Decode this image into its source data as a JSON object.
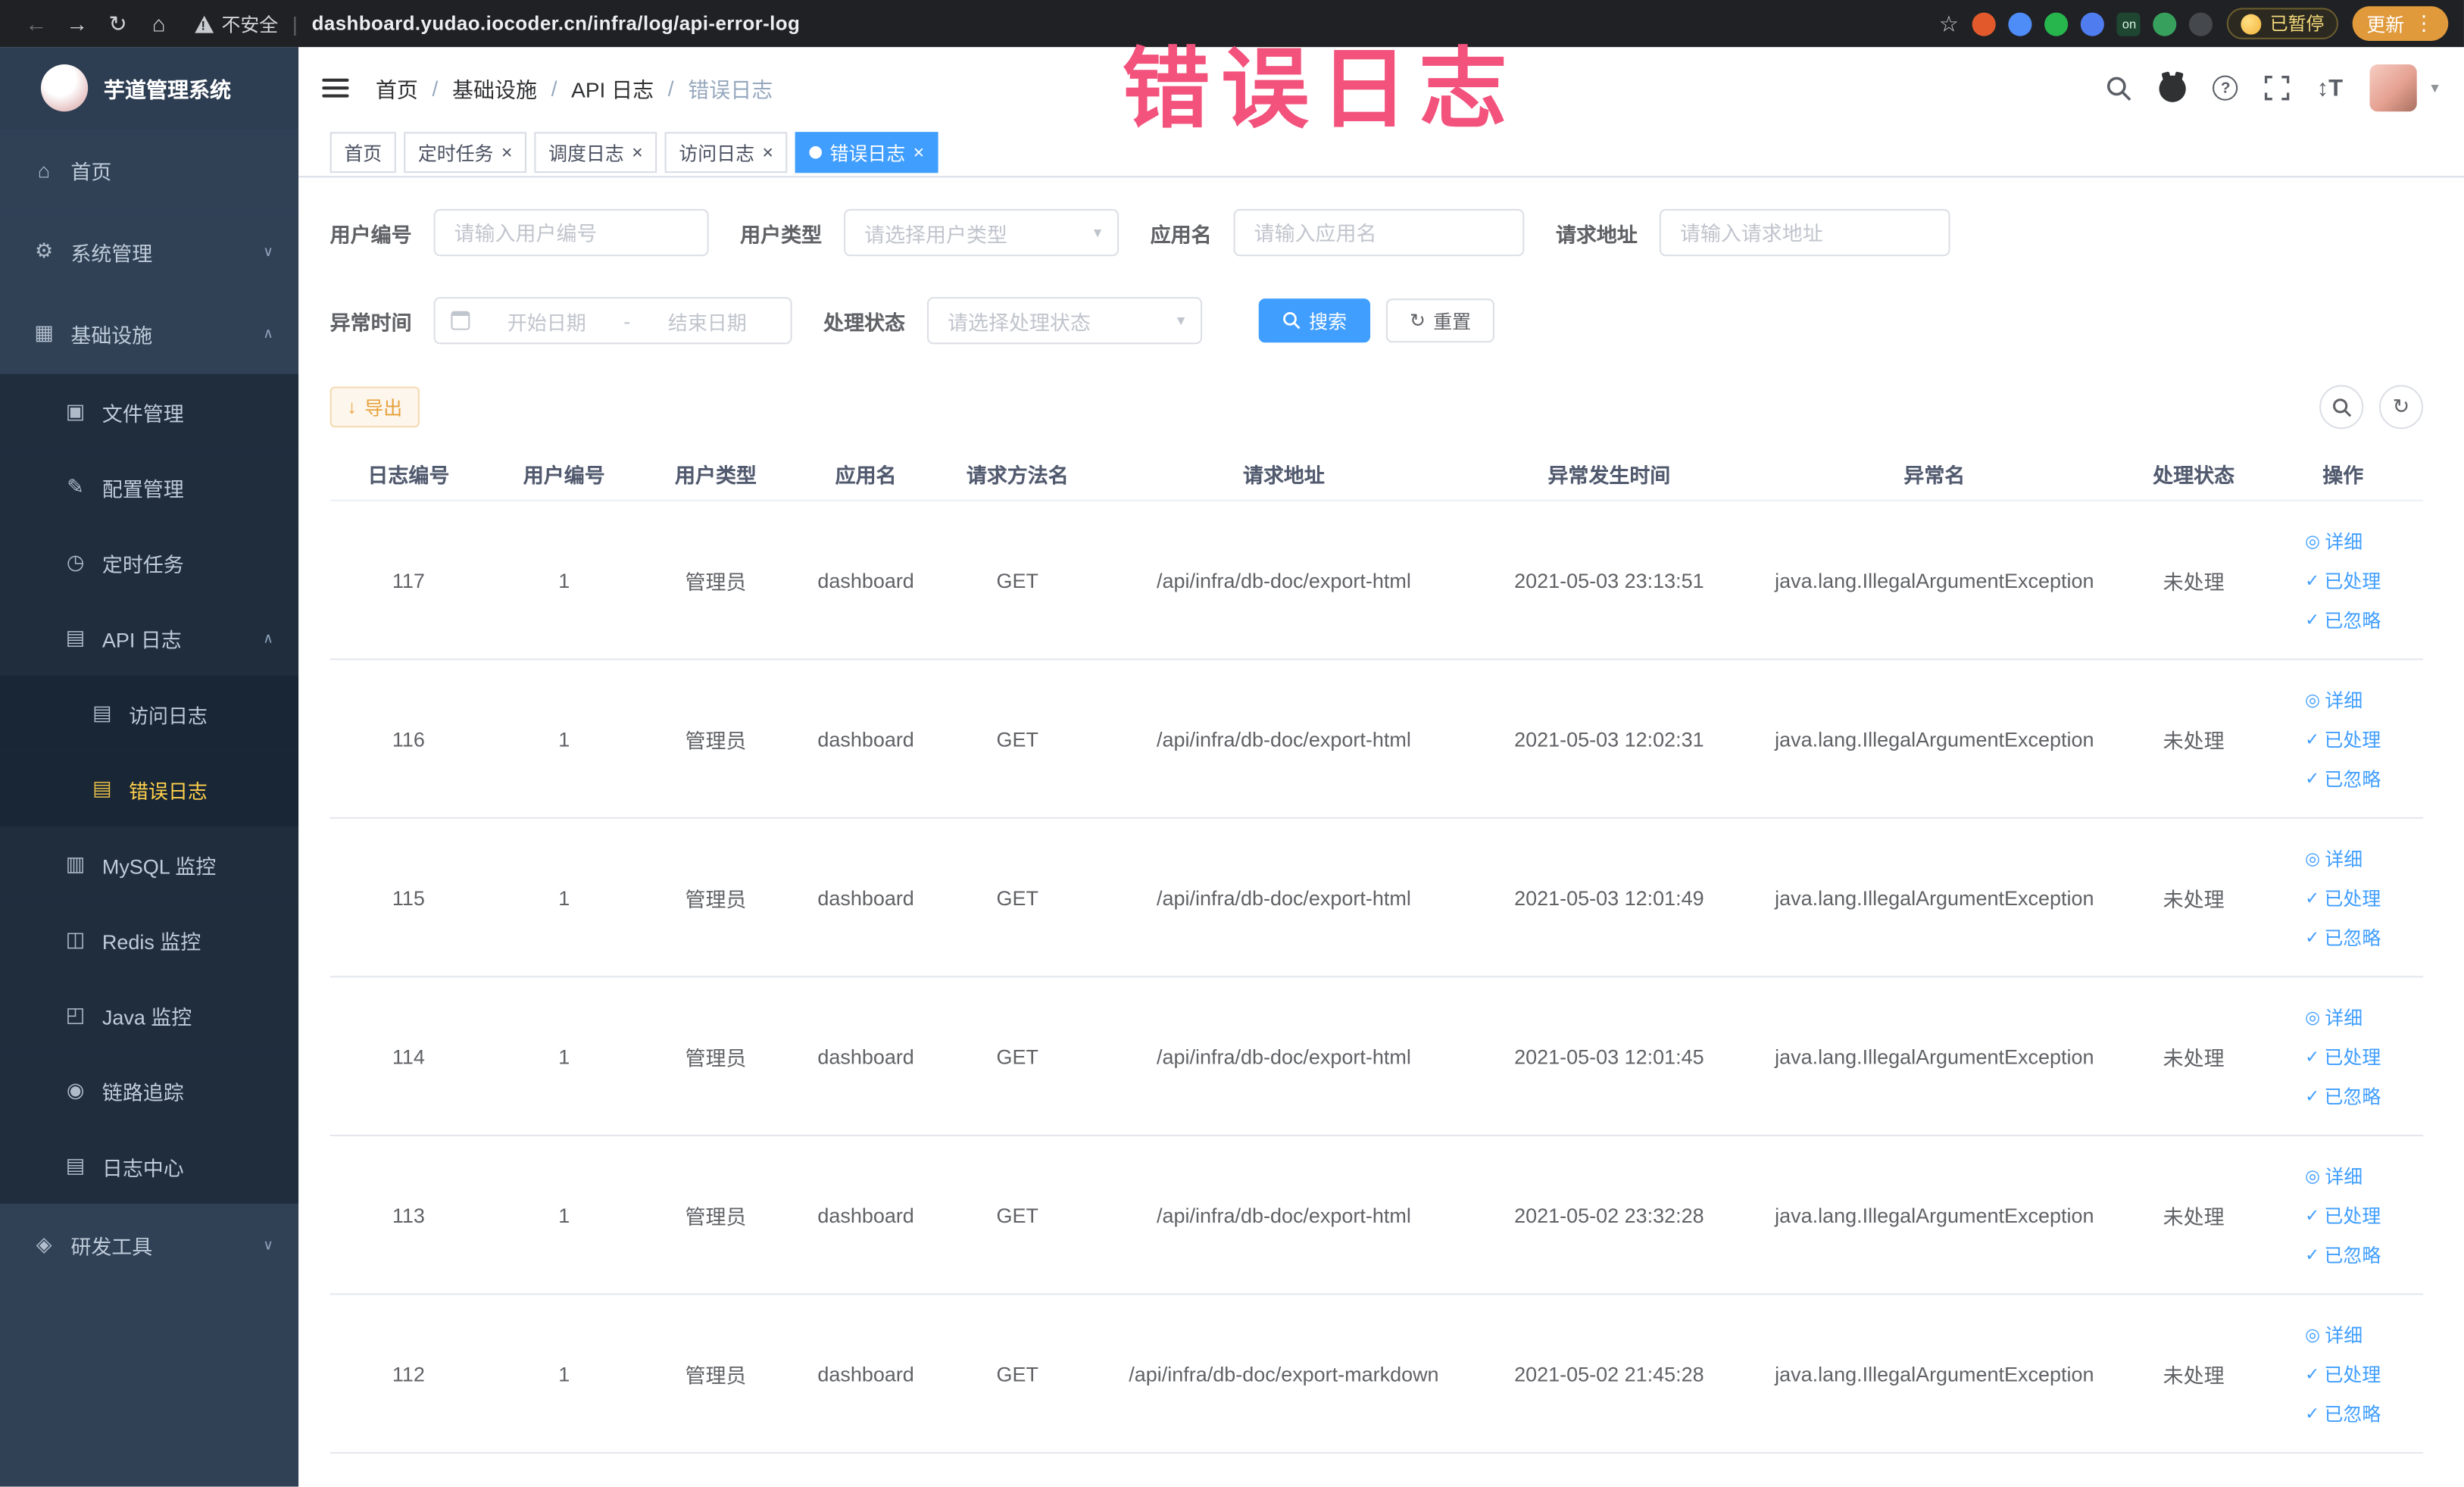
{
  "annotation": {
    "text": "错误日志"
  },
  "browser": {
    "security_label": "不安全",
    "url": "dashboard.yudao.iocoder.cn/infra/log/api-error-log",
    "paused_badge": "已暂停",
    "update_button": "更新",
    "extensions": [
      {
        "icon": "extension-dot-icon",
        "color": "#e25a2b"
      },
      {
        "icon": "extension-drop-icon",
        "color": "#4e8cf7"
      },
      {
        "icon": "extension-circle-icon",
        "color": "#27b64e"
      },
      {
        "icon": "extension-grid-icon",
        "color": "#4f7df0"
      },
      {
        "icon": "extension-on-badge-icon",
        "color": "#1e4631",
        "label": "on"
      },
      {
        "icon": "extension-leaf-icon",
        "color": "#37a05c"
      },
      {
        "icon": "extension-pin-icon",
        "color": "#45484c"
      }
    ]
  },
  "sidebar": {
    "logo_title": "芋道管理系统",
    "items": [
      {
        "label": "首页",
        "icon": "home-icon",
        "level": 0
      },
      {
        "label": "系统管理",
        "icon": "gear-icon",
        "level": 0,
        "chevron": "down"
      },
      {
        "label": "基础设施",
        "icon": "infra-icon",
        "level": 0,
        "chevron": "up"
      },
      {
        "label": "文件管理",
        "icon": "file-icon",
        "level": 1
      },
      {
        "label": "配置管理",
        "icon": "config-icon",
        "level": 1
      },
      {
        "label": "定时任务",
        "icon": "job-icon",
        "level": 1
      },
      {
        "label": "API 日志",
        "icon": "api-log-icon",
        "level": 1,
        "chevron": "up"
      },
      {
        "label": "访问日志",
        "icon": "doc-icon",
        "level": 2
      },
      {
        "label": "错误日志",
        "icon": "doc-icon",
        "level": 2,
        "active": true
      },
      {
        "label": "MySQL 监控",
        "icon": "mysql-icon",
        "level": 1
      },
      {
        "label": "Redis 监控",
        "icon": "redis-icon",
        "level": 1
      },
      {
        "label": "Java 监控",
        "icon": "java-icon",
        "level": 1
      },
      {
        "label": "链路追踪",
        "icon": "trace-icon",
        "level": 1
      },
      {
        "label": "日志中心",
        "icon": "log-center-icon",
        "level": 1
      },
      {
        "label": "研发工具",
        "icon": "tool-icon",
        "level": 0,
        "chevron": "down"
      }
    ]
  },
  "header": {
    "breadcrumb": [
      "首页",
      "基础设施",
      "API 日志",
      "错误日志"
    ]
  },
  "tabs": [
    {
      "label": "首页",
      "closable": false,
      "active": false
    },
    {
      "label": "定时任务",
      "closable": true,
      "active": false
    },
    {
      "label": "调度日志",
      "closable": true,
      "active": false
    },
    {
      "label": "访问日志",
      "closable": true,
      "active": false
    },
    {
      "label": "错误日志",
      "closable": true,
      "active": true
    }
  ],
  "filters": {
    "user_id_label": "用户编号",
    "user_id_placeholder": "请输入用户编号",
    "user_type_label": "用户类型",
    "user_type_placeholder": "请选择用户类型",
    "app_name_label": "应用名",
    "app_name_placeholder": "请输入应用名",
    "request_url_label": "请求地址",
    "request_url_placeholder": "请输入请求地址",
    "exception_time_label": "异常时间",
    "date_start_placeholder": "开始日期",
    "date_separator": "-",
    "date_end_placeholder": "结束日期",
    "status_label": "处理状态",
    "status_placeholder": "请选择处理状态",
    "search_button": "搜索",
    "reset_button": "重置"
  },
  "toolbar": {
    "export_button": "导出"
  },
  "table": {
    "columns": [
      "日志编号",
      "用户编号",
      "用户类型",
      "应用名",
      "请求方法名",
      "请求地址",
      "异常发生时间",
      "异常名",
      "处理状态",
      "操作"
    ],
    "actions": {
      "detail": "详细",
      "processed": "已处理",
      "ignored": "已忽略"
    },
    "rows": [
      {
        "log_id": "117",
        "user_id": "1",
        "user_type": "管理员",
        "app": "dashboard",
        "method": "GET",
        "url": "/api/infra/db-doc/export-html",
        "time": "2021-05-03 23:13:51",
        "exception": "java.lang.IllegalArgumentException",
        "status": "未处理"
      },
      {
        "log_id": "116",
        "user_id": "1",
        "user_type": "管理员",
        "app": "dashboard",
        "method": "GET",
        "url": "/api/infra/db-doc/export-html",
        "time": "2021-05-03 12:02:31",
        "exception": "java.lang.IllegalArgumentException",
        "status": "未处理"
      },
      {
        "log_id": "115",
        "user_id": "1",
        "user_type": "管理员",
        "app": "dashboard",
        "method": "GET",
        "url": "/api/infra/db-doc/export-html",
        "time": "2021-05-03 12:01:49",
        "exception": "java.lang.IllegalArgumentException",
        "status": "未处理"
      },
      {
        "log_id": "114",
        "user_id": "1",
        "user_type": "管理员",
        "app": "dashboard",
        "method": "GET",
        "url": "/api/infra/db-doc/export-html",
        "time": "2021-05-03 12:01:45",
        "exception": "java.lang.IllegalArgumentException",
        "status": "未处理"
      },
      {
        "log_id": "113",
        "user_id": "1",
        "user_type": "管理员",
        "app": "dashboard",
        "method": "GET",
        "url": "/api/infra/db-doc/export-html",
        "time": "2021-05-02 23:32:28",
        "exception": "java.lang.IllegalArgumentException",
        "status": "未处理"
      },
      {
        "log_id": "112",
        "user_id": "1",
        "user_type": "管理员",
        "app": "dashboard",
        "method": "GET",
        "url": "/api/infra/db-doc/export-markdown",
        "time": "2021-05-02 21:45:28",
        "exception": "java.lang.IllegalArgumentException",
        "status": "未处理"
      }
    ]
  },
  "colors": {
    "accent": "#409eff",
    "sidebar_bg": "#304156",
    "submenu_bg": "#1f2d3d",
    "active_menu_text": "#ffd04b",
    "warning": "#e6a23c",
    "annotation": "#f2527c"
  }
}
